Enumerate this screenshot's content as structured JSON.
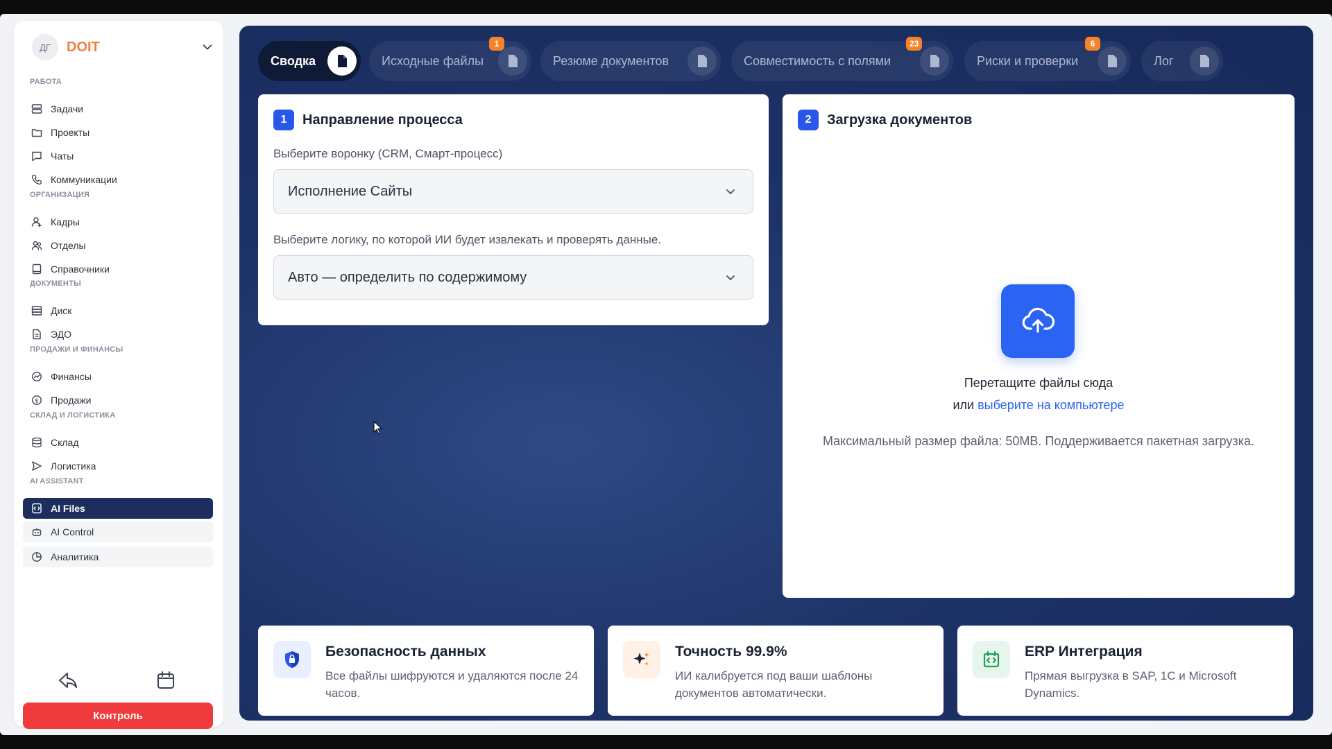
{
  "sidebar": {
    "workspace": {
      "avatar": "ДГ",
      "name": "DOIT"
    },
    "sections": {
      "work": "РАБОТА",
      "org": "ОРГАНИЗАЦИЯ",
      "docs": "ДОКУМЕНТЫ",
      "sales": "ПРОДАЖИ И ФИНАНСЫ",
      "warehouse": "СКЛАД И ЛОГИСТИКА",
      "ai": "AI ASSISTANT"
    },
    "items": [
      {
        "label": "Задачи",
        "icon": "tasks-icon"
      },
      {
        "label": "Проекты",
        "icon": "folder-icon"
      },
      {
        "label": "Чаты",
        "icon": "chat-icon"
      },
      {
        "label": "Коммуникации",
        "icon": "phone-icon"
      },
      {
        "label": "Кадры",
        "icon": "user-icon"
      },
      {
        "label": "Отделы",
        "icon": "users-icon"
      },
      {
        "label": "Справочники",
        "icon": "book-icon"
      },
      {
        "label": "Диск",
        "icon": "database-icon"
      },
      {
        "label": "ЭДО",
        "icon": "document-icon"
      },
      {
        "label": "Финансы",
        "icon": "finance-icon"
      },
      {
        "label": "Продажи",
        "icon": "dollar-icon"
      },
      {
        "label": "Склад",
        "icon": "warehouse-icon"
      },
      {
        "label": "Логистика",
        "icon": "send-icon"
      },
      {
        "label": "AI Files",
        "icon": "ai-file-icon"
      },
      {
        "label": "AI Control",
        "icon": "robot-icon"
      },
      {
        "label": "Аналитика",
        "icon": "pie-chart-icon"
      }
    ],
    "control_button": "Контроль"
  },
  "tabs": [
    {
      "label": "Сводка",
      "badge": ""
    },
    {
      "label": "Исходные файлы",
      "badge": "1"
    },
    {
      "label": "Резюме документов",
      "badge": ""
    },
    {
      "label": "Совместимость с полями",
      "badge": "23"
    },
    {
      "label": "Риски и проверки",
      "badge": "6"
    },
    {
      "label": "Лог",
      "badge": ""
    }
  ],
  "process": {
    "step": "1",
    "title": "Направление процесса",
    "funnel_label": "Выберите воронку (CRM, Смарт-процесс)",
    "funnel_value": "Исполнение Сайты",
    "logic_label": "Выберите логику, по которой ИИ будет извлекать и проверять данные.",
    "logic_value": "Авто — определить по содержимому"
  },
  "upload": {
    "step": "2",
    "title": "Загрузка документов",
    "drop_text": "Перетащите файлы сюда",
    "or_text": "или",
    "link_text": "выберите на компьютере",
    "note": "Максимальный размер файла: 50MB. Поддерживается пакетная загрузка."
  },
  "features": [
    {
      "title": "Безопасность данных",
      "desc": "Все файлы шифруются и удаляются после 24 часов.",
      "icon": "shield-icon"
    },
    {
      "title": "Точность 99.9%",
      "desc": "ИИ калибруется под ваши шаблоны документов автоматически.",
      "icon": "sparkles-icon"
    },
    {
      "title": "ERP Интеграция",
      "desc": "Прямая выгрузка в SAP, 1С и Microsoft Dynamics.",
      "icon": "code-box-icon"
    }
  ],
  "colors": {
    "accent": "#2957ea",
    "brand": "#f07f3c",
    "danger": "#ef3b3b",
    "badge": "#f5832c",
    "panel": "#1d3266"
  }
}
